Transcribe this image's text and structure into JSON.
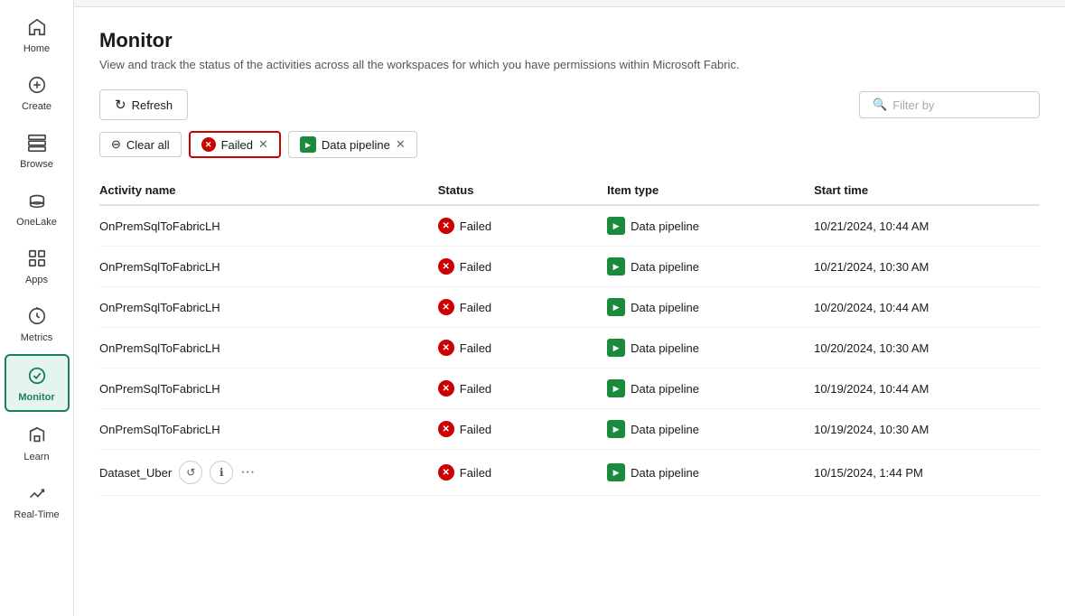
{
  "sidebar": {
    "items": [
      {
        "id": "home",
        "label": "Home",
        "icon": "home"
      },
      {
        "id": "create",
        "label": "Create",
        "icon": "create"
      },
      {
        "id": "browse",
        "label": "Browse",
        "icon": "browse"
      },
      {
        "id": "onelake",
        "label": "OneLake",
        "icon": "onelake"
      },
      {
        "id": "apps",
        "label": "Apps",
        "icon": "apps"
      },
      {
        "id": "metrics",
        "label": "Metrics",
        "icon": "metrics"
      },
      {
        "id": "monitor",
        "label": "Monitor",
        "icon": "monitor",
        "active": true
      },
      {
        "id": "learn",
        "label": "Learn",
        "icon": "learn"
      },
      {
        "id": "realtime",
        "label": "Real-Time",
        "icon": "realtime"
      }
    ]
  },
  "page": {
    "title": "Monitor",
    "subtitle": "View and track the status of the activities across all the workspaces for which you have permissions within Microsoft Fabric."
  },
  "toolbar": {
    "refresh_label": "Refresh",
    "filter_placeholder": "Filter by"
  },
  "filter_chips": {
    "clear_all_label": "Clear all",
    "chips": [
      {
        "id": "failed",
        "label": "Failed",
        "type": "status"
      },
      {
        "id": "data-pipeline",
        "label": "Data pipeline",
        "type": "item-type"
      }
    ]
  },
  "table": {
    "columns": [
      {
        "id": "activity_name",
        "label": "Activity name"
      },
      {
        "id": "status",
        "label": "Status"
      },
      {
        "id": "item_type",
        "label": "Item type"
      },
      {
        "id": "start_time",
        "label": "Start time"
      }
    ],
    "rows": [
      {
        "activity_name": "OnPremSqlToFabricLH",
        "status": "Failed",
        "item_type": "Data pipeline",
        "start_time": "10/21/2024, 10:44 AM",
        "show_actions": false
      },
      {
        "activity_name": "OnPremSqlToFabricLH",
        "status": "Failed",
        "item_type": "Data pipeline",
        "start_time": "10/21/2024, 10:30 AM",
        "show_actions": false
      },
      {
        "activity_name": "OnPremSqlToFabricLH",
        "status": "Failed",
        "item_type": "Data pipeline",
        "start_time": "10/20/2024, 10:44 AM",
        "show_actions": false
      },
      {
        "activity_name": "OnPremSqlToFabricLH",
        "status": "Failed",
        "item_type": "Data pipeline",
        "start_time": "10/20/2024, 10:30 AM",
        "show_actions": false
      },
      {
        "activity_name": "OnPremSqlToFabricLH",
        "status": "Failed",
        "item_type": "Data pipeline",
        "start_time": "10/19/2024, 10:44 AM",
        "show_actions": false
      },
      {
        "activity_name": "OnPremSqlToFabricLH",
        "status": "Failed",
        "item_type": "Data pipeline",
        "start_time": "10/19/2024, 10:30 AM",
        "show_actions": false
      },
      {
        "activity_name": "Dataset_Uber",
        "status": "Failed",
        "item_type": "Data pipeline",
        "start_time": "10/15/2024, 1:44 PM",
        "show_actions": true
      }
    ]
  }
}
